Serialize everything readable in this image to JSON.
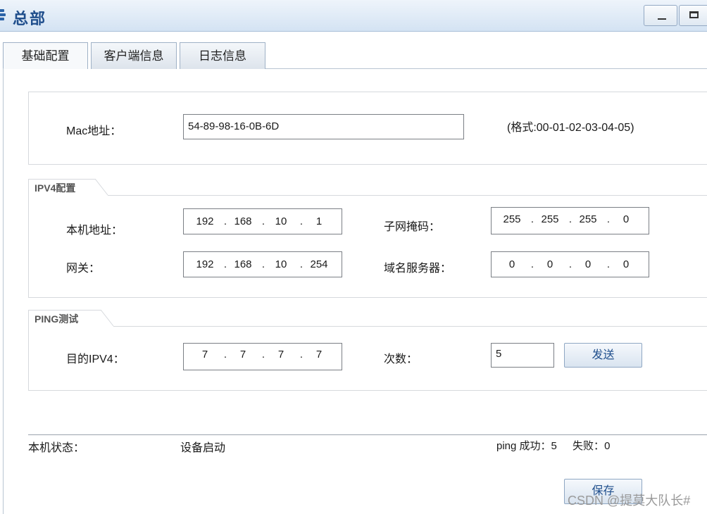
{
  "window": {
    "title": "总部",
    "minimize_icon": "minimize-icon",
    "maximize_icon": "maximize-icon"
  },
  "tabs": [
    {
      "label": "基础配置",
      "active": true
    },
    {
      "label": "客户端信息",
      "active": false
    },
    {
      "label": "日志信息",
      "active": false
    }
  ],
  "mac": {
    "label": "Mac地址：",
    "value": "54-89-98-16-0B-6D",
    "hint": "(格式:00-01-02-03-04-05)"
  },
  "ipv4": {
    "section_title": "IPV4配置",
    "local_addr": {
      "label": "本机地址：",
      "octets": [
        "192",
        "168",
        "10",
        "1"
      ]
    },
    "gateway": {
      "label": "网关：",
      "octets": [
        "192",
        "168",
        "10",
        "254"
      ]
    },
    "subnet_mask": {
      "label": "子网掩码：",
      "octets": [
        "255",
        "255",
        "255",
        "0"
      ]
    },
    "dns": {
      "label": "域名服务器：",
      "octets": [
        "0",
        "0",
        "0",
        "0"
      ]
    }
  },
  "ping": {
    "section_title": "PING测试",
    "dest": {
      "label": "目的IPV4：",
      "octets": [
        "7",
        "7",
        "7",
        "7"
      ]
    },
    "count": {
      "label": "次数：",
      "value": "5"
    },
    "send_label": "发送"
  },
  "status": {
    "label": "本机状态：",
    "value": "设备启动",
    "ping_success_label": "ping 成功：",
    "ping_success": "5",
    "ping_fail_label": "失败：",
    "ping_fail": "0"
  },
  "save_label": "保存",
  "watermark": "CSDN @提莫大队长#"
}
